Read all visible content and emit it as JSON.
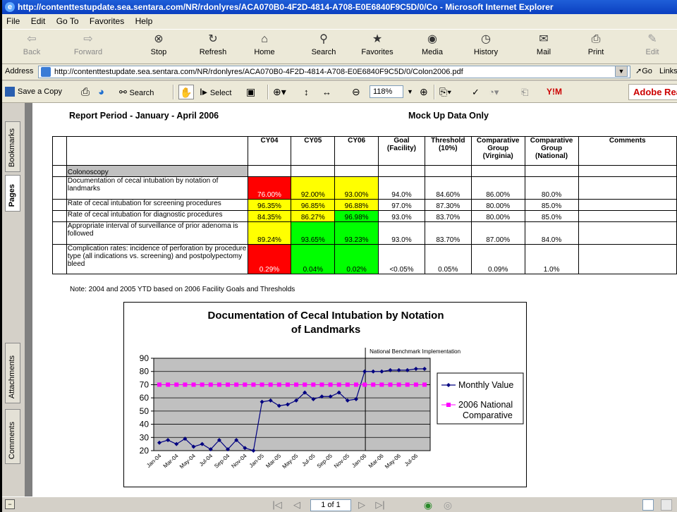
{
  "window": {
    "title": "http://contenttestupdate.sea.sentara.com/NR/rdonlyres/ACA070B0-4F2D-4814-A708-E0E6840F9C5D/0/Co - Microsoft Internet Explorer"
  },
  "menu": [
    "File",
    "Edit",
    "Go To",
    "Favorites",
    "Help"
  ],
  "toolbar": {
    "back": "Back",
    "forward": "Forward",
    "stop": "Stop",
    "refresh": "Refresh",
    "home": "Home",
    "search": "Search",
    "favorites": "Favorites",
    "media": "Media",
    "history": "History",
    "mail": "Mail",
    "print": "Print",
    "edit": "Edit"
  },
  "address": {
    "label": "Address",
    "url": "http://contenttestupdate.sea.sentara.com/NR/rdonlyres/ACA070B0-4F2D-4814-A708-E0E6840F9C5D/0/Colon2006.pdf",
    "go": "Go",
    "links": "Links"
  },
  "acrobat": {
    "save_copy": "Save a Copy",
    "search": "Search",
    "select": "Select",
    "zoom": "118%",
    "brand": "Adobe Rea"
  },
  "side_tabs": {
    "bookmarks": "Bookmarks",
    "pages": "Pages",
    "attachments": "Attachments",
    "comments": "Comments"
  },
  "status": {
    "page_indicator": "1 of 1"
  },
  "report": {
    "period": "Report Period - January - April 2006",
    "mockup": "Mock Up Data Only",
    "note": "Note:  2004 and 2005 YTD based on 2006 Facility Goals and Thresholds",
    "headers": [
      "CY04",
      "CY05",
      "CY06",
      "Goal (Facility)",
      "Threshold (10%)",
      "Comparative Group (Virginia)",
      "Comparative Group (National)",
      "Comments"
    ],
    "section": "Colonoscopy",
    "rows": [
      {
        "label": "Documentation of cecal intubation by notation of landmarks",
        "cy04": "76.00%",
        "cy05": "92.00%",
        "cy06": "93.00%",
        "goal": "94.0%",
        "threshold": "84.60%",
        "virginia": "86.00%",
        "national": "80.0%",
        "c04": "red",
        "c05": "yel",
        "c06": "yel"
      },
      {
        "label": "Rate of cecal intubation for screening procedures",
        "cy04": "96.35%",
        "cy05": "96.85%",
        "cy06": "96.88%",
        "goal": "97.0%",
        "threshold": "87.30%",
        "virginia": "80.00%",
        "national": "85.0%",
        "c04": "yel",
        "c05": "yel",
        "c06": "yel"
      },
      {
        "label": "Rate of cecal intubation for diagnostic procedures",
        "cy04": "84.35%",
        "cy05": "86.27%",
        "cy06": "96.98%",
        "goal": "93.0%",
        "threshold": "83.70%",
        "virginia": "80.00%",
        "national": "85.0%",
        "c04": "yel",
        "c05": "yel",
        "c06": "grn"
      },
      {
        "label": "Appropriate interval of surveillance of prior adenoma is followed",
        "cy04": "89.24%",
        "cy05": "93.65%",
        "cy06": "93.23%",
        "goal": "93.0%",
        "threshold": "83.70%",
        "virginia": "87.00%",
        "national": "84.0%",
        "c04": "yel",
        "c05": "grn",
        "c06": "grn"
      },
      {
        "label": "Complication rates:  incidence of perforation by procedure type (all indications vs. screening) and postpolypectomy bleed",
        "cy04": "0.29%",
        "cy05": "0.04%",
        "cy06": "0.02%",
        "goal": "<0.05%",
        "threshold": "0.05%",
        "virginia": "0.09%",
        "national": "1.0%",
        "c04": "red",
        "c05": "grn",
        "c06": "grn"
      }
    ]
  },
  "chart_data": {
    "type": "line",
    "title": "Documentation of Cecal Intubation by Notation of Landmarks",
    "annotation": "National Benchmark Implementation",
    "x": [
      "Jan-04",
      "Feb-04",
      "Mar-04",
      "Apr-04",
      "May-04",
      "Jun-04",
      "Jul-04",
      "Aug-04",
      "Sep-04",
      "Oct-04",
      "Nov-04",
      "Dec-04",
      "Jan-05",
      "Feb-05",
      "Mar-05",
      "Apr-05",
      "May-05",
      "Jun-05",
      "Jul-05",
      "Aug-05",
      "Sep-05",
      "Oct-05",
      "Nov-05",
      "Dec-05",
      "Jan-06",
      "Feb-06",
      "Mar-06",
      "Apr-06",
      "May-06",
      "Jun-06",
      "Jul-06",
      "Aug-06"
    ],
    "xticks": [
      "Jan-04",
      "Mar-04",
      "May-04",
      "Jul-04",
      "Sep-04",
      "Nov-04",
      "Jan-05",
      "Mar-05",
      "May-05",
      "Jul-05",
      "Sep-05",
      "Nov-05",
      "Jan-06",
      "Mar-06",
      "May-06",
      "Jul-06"
    ],
    "series": [
      {
        "name": "Monthly Value",
        "color": "#000080",
        "values": [
          26,
          28,
          25,
          29,
          23,
          25,
          21,
          28,
          21,
          28,
          22,
          20,
          57,
          58,
          54,
          55,
          58,
          64,
          59,
          61,
          61,
          64,
          58,
          59,
          80,
          80,
          80,
          81,
          81,
          81,
          82,
          82
        ]
      },
      {
        "name": "2006 National Comparative",
        "color": "#ff00ff",
        "values": [
          70,
          70,
          70,
          70,
          70,
          70,
          70,
          70,
          70,
          70,
          70,
          70,
          70,
          70,
          70,
          70,
          70,
          70,
          70,
          70,
          70,
          70,
          70,
          70,
          70,
          70,
          70,
          70,
          70,
          70,
          70,
          70
        ]
      }
    ],
    "ylim": [
      20,
      90
    ],
    "yticks": [
      20,
      30,
      40,
      50,
      60,
      70,
      80,
      90
    ],
    "grid": true,
    "legend": "right",
    "plot_bg": "#c0c0c0"
  }
}
